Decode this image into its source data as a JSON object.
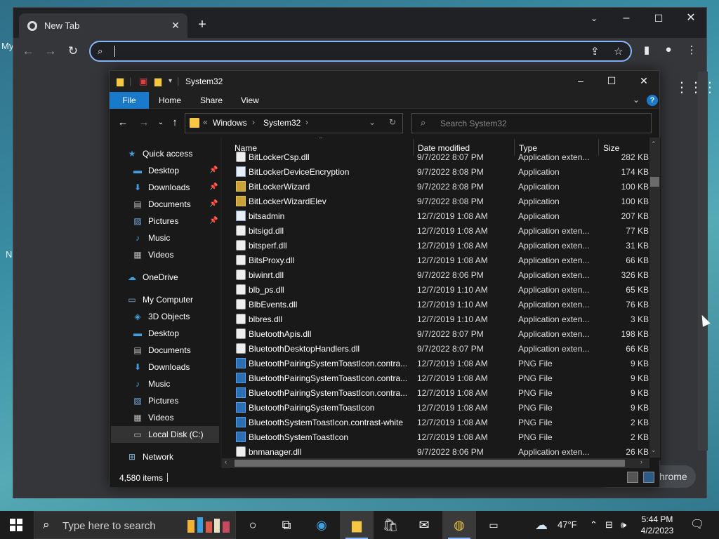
{
  "desktop": {
    "fragment_my": "My",
    "fragment_n": "N"
  },
  "chrome": {
    "tab_title": "New Tab",
    "new_tab_glyph": "+",
    "chip_label": "hrome",
    "accent": "#8ab4f8"
  },
  "explorer": {
    "title": "System32",
    "ribbon": {
      "file": "File",
      "home": "Home",
      "share": "Share",
      "view": "View"
    },
    "breadcrumb": [
      "Windows",
      "System32"
    ],
    "search_placeholder": "Search System32",
    "nav": [
      {
        "label": "Quick access",
        "icon": "star-icon",
        "pinned": false
      },
      {
        "label": "Desktop",
        "icon": "desktop-folder-icon",
        "pinned": true
      },
      {
        "label": "Downloads",
        "icon": "download-folder-icon",
        "pinned": true
      },
      {
        "label": "Documents",
        "icon": "documents-folder-icon",
        "pinned": true
      },
      {
        "label": "Pictures",
        "icon": "pictures-folder-icon",
        "pinned": true
      },
      {
        "label": "Music",
        "icon": "music-folder-icon",
        "pinned": false
      },
      {
        "label": "Videos",
        "icon": "videos-folder-icon",
        "pinned": false
      },
      {
        "label": "OneDrive",
        "icon": "cloud-icon",
        "pinned": false
      },
      {
        "label": "My Computer",
        "icon": "computer-icon",
        "pinned": false
      },
      {
        "label": "3D Objects",
        "icon": "3d-objects-icon",
        "pinned": false
      },
      {
        "label": "Desktop",
        "icon": "desktop-folder-icon",
        "pinned": false
      },
      {
        "label": "Documents",
        "icon": "documents-folder-icon",
        "pinned": false
      },
      {
        "label": "Downloads",
        "icon": "download-folder-icon",
        "pinned": false
      },
      {
        "label": "Music",
        "icon": "music-folder-icon",
        "pinned": false
      },
      {
        "label": "Pictures",
        "icon": "pictures-folder-icon",
        "pinned": false
      },
      {
        "label": "Videos",
        "icon": "videos-folder-icon",
        "pinned": false
      },
      {
        "label": "Local Disk (C:)",
        "icon": "drive-icon",
        "pinned": false,
        "selected": true
      },
      {
        "label": "Network",
        "icon": "network-icon",
        "pinned": false
      }
    ],
    "columns": {
      "name": "Name",
      "date": "Date modified",
      "type": "Type",
      "size": "Size"
    },
    "files": [
      {
        "name": "BitLockerCsp.dll",
        "date": "9/7/2022 8:07 PM",
        "type": "Application exten...",
        "size": "282 KB",
        "kind": "dll"
      },
      {
        "name": "BitLockerDeviceEncryption",
        "date": "9/7/2022 8:08 PM",
        "type": "Application",
        "size": "174 KB",
        "kind": "app"
      },
      {
        "name": "BitLockerWizard",
        "date": "9/7/2022 8:08 PM",
        "type": "Application",
        "size": "100 KB",
        "kind": "wiz"
      },
      {
        "name": "BitLockerWizardElev",
        "date": "9/7/2022 8:08 PM",
        "type": "Application",
        "size": "100 KB",
        "kind": "wiz"
      },
      {
        "name": "bitsadmin",
        "date": "12/7/2019 1:08 AM",
        "type": "Application",
        "size": "207 KB",
        "kind": "app"
      },
      {
        "name": "bitsigd.dll",
        "date": "12/7/2019 1:08 AM",
        "type": "Application exten...",
        "size": "77 KB",
        "kind": "dll"
      },
      {
        "name": "bitsperf.dll",
        "date": "12/7/2019 1:08 AM",
        "type": "Application exten...",
        "size": "31 KB",
        "kind": "dll"
      },
      {
        "name": "BitsProxy.dll",
        "date": "12/7/2019 1:08 AM",
        "type": "Application exten...",
        "size": "66 KB",
        "kind": "dll"
      },
      {
        "name": "biwinrt.dll",
        "date": "9/7/2022 8:06 PM",
        "type": "Application exten...",
        "size": "326 KB",
        "kind": "dll"
      },
      {
        "name": "blb_ps.dll",
        "date": "12/7/2019 1:10 AM",
        "type": "Application exten...",
        "size": "65 KB",
        "kind": "dll"
      },
      {
        "name": "BlbEvents.dll",
        "date": "12/7/2019 1:10 AM",
        "type": "Application exten...",
        "size": "76 KB",
        "kind": "dll"
      },
      {
        "name": "blbres.dll",
        "date": "12/7/2019 1:10 AM",
        "type": "Application exten...",
        "size": "3 KB",
        "kind": "dll"
      },
      {
        "name": "BluetoothApis.dll",
        "date": "9/7/2022 8:07 PM",
        "type": "Application exten...",
        "size": "198 KB",
        "kind": "dll"
      },
      {
        "name": "BluetoothDesktopHandlers.dll",
        "date": "9/7/2022 8:07 PM",
        "type": "Application exten...",
        "size": "66 KB",
        "kind": "dll"
      },
      {
        "name": "BluetoothPairingSystemToastIcon.contra...",
        "date": "12/7/2019 1:08 AM",
        "type": "PNG File",
        "size": "9 KB",
        "kind": "png"
      },
      {
        "name": "BluetoothPairingSystemToastIcon.contra...",
        "date": "12/7/2019 1:08 AM",
        "type": "PNG File",
        "size": "9 KB",
        "kind": "png"
      },
      {
        "name": "BluetoothPairingSystemToastIcon.contra...",
        "date": "12/7/2019 1:08 AM",
        "type": "PNG File",
        "size": "9 KB",
        "kind": "png"
      },
      {
        "name": "BluetoothPairingSystemToastIcon",
        "date": "12/7/2019 1:08 AM",
        "type": "PNG File",
        "size": "9 KB",
        "kind": "png"
      },
      {
        "name": "BluetoothSystemToastIcon.contrast-white",
        "date": "12/7/2019 1:08 AM",
        "type": "PNG File",
        "size": "2 KB",
        "kind": "png"
      },
      {
        "name": "BluetoothSystemToastIcon",
        "date": "12/7/2019 1:08 AM",
        "type": "PNG File",
        "size": "2 KB",
        "kind": "png"
      },
      {
        "name": "bnmanager.dll",
        "date": "9/7/2022 8:06 PM",
        "type": "Application exten...",
        "size": "26 KB",
        "kind": "dll"
      }
    ],
    "status_count": "4,580 items"
  },
  "taskbar": {
    "search_placeholder": "Type here to search",
    "weather": "47°F",
    "time": "5:44 PM",
    "date": "4/2/2023"
  }
}
